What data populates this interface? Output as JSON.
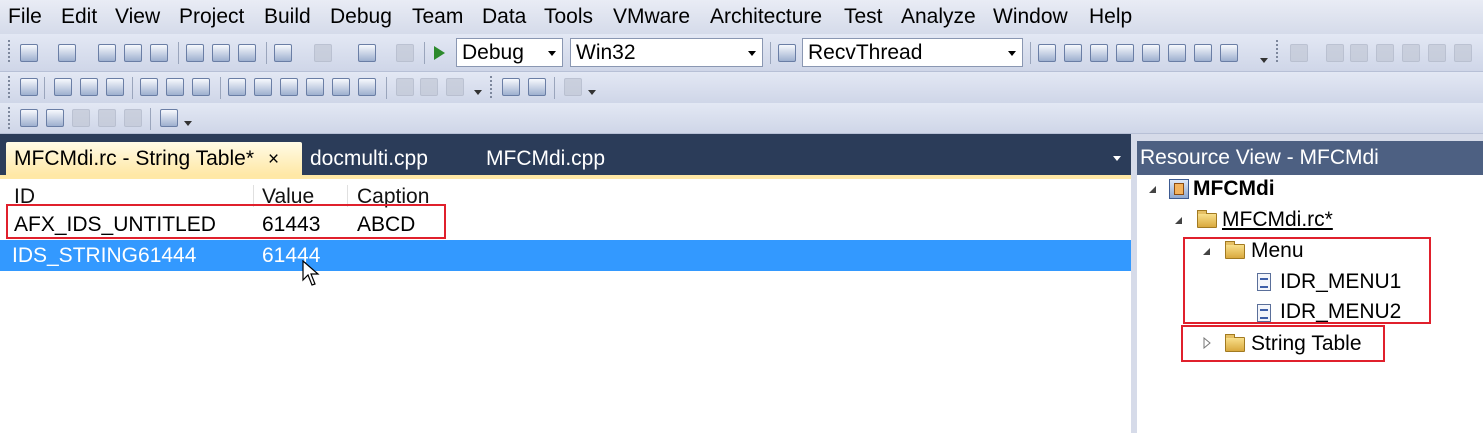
{
  "menu": [
    "File",
    "Edit",
    "View",
    "Project",
    "Build",
    "Debug",
    "Team",
    "Data",
    "Tools",
    "VMware",
    "Architecture",
    "Test",
    "Analyze",
    "Window",
    "Help"
  ],
  "toolbar": {
    "config_value": "Debug",
    "platform_value": "Win32",
    "find_value": "RecvThread"
  },
  "tabs": [
    {
      "label": "MFCMdi.rc - String Table*",
      "close": "×",
      "active": true
    },
    {
      "label": "docmulti.cpp",
      "active": false
    },
    {
      "label": "MFCMdi.cpp",
      "active": false
    }
  ],
  "string_table": {
    "columns": [
      "ID",
      "Value",
      "Caption"
    ],
    "rows": [
      {
        "id": "AFX_IDS_UNTITLED",
        "value": "61443",
        "caption": "ABCD",
        "selected": false
      },
      {
        "id": "IDS_STRING61444",
        "value": "61444",
        "caption": "",
        "selected": true
      }
    ]
  },
  "resource_view": {
    "title": "Resource View - MFCMdi",
    "tree": {
      "project": "MFCMdi",
      "rc_file": "MFCMdi.rc*",
      "menu_folder": "Menu",
      "menu_items": [
        "IDR_MENU1",
        "IDR_MENU2"
      ],
      "string_table_folder": "String Table"
    }
  },
  "colors": {
    "selection": "#3399ff",
    "annotation": "#e0202c",
    "active_tab": "#ffe8a6",
    "tabstrip": "#2b3c59"
  }
}
